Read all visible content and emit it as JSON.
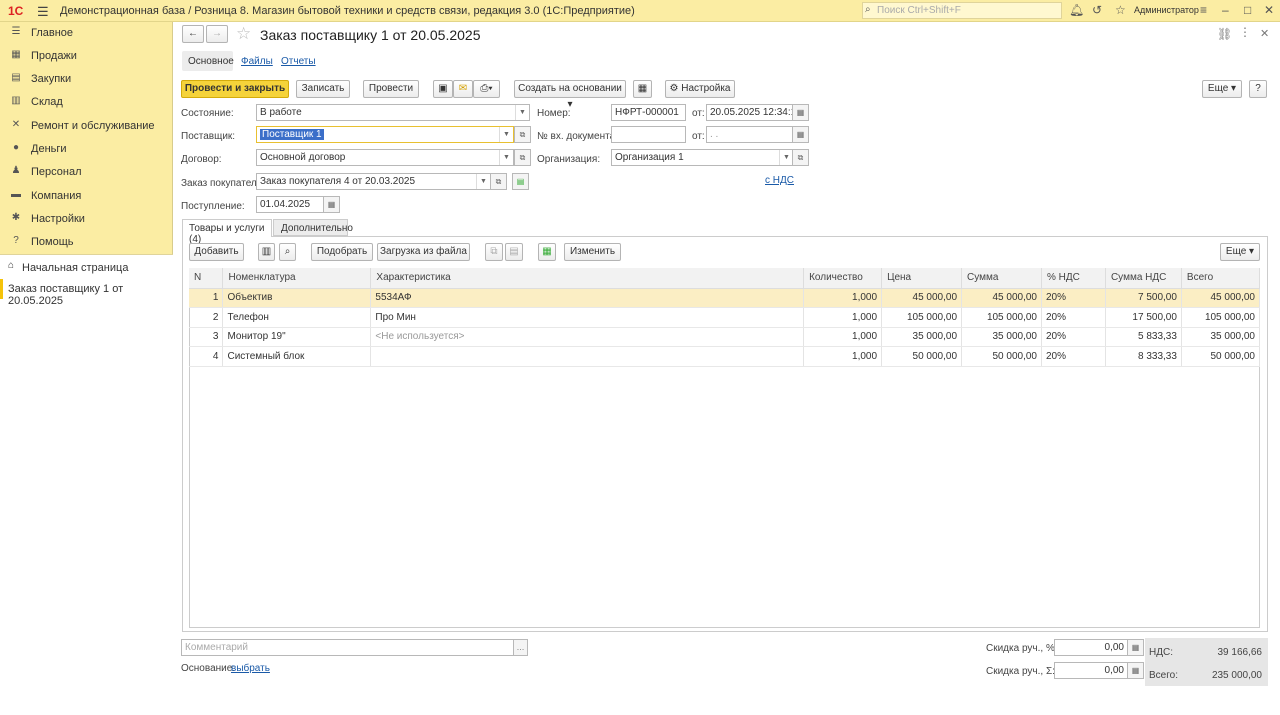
{
  "app": {
    "logo": "1С",
    "title": "Демонстрационная база / Розница 8. Магазин бытовой техники и средств связи, редакция 3.0  (1С:Предприятие)",
    "search_placeholder": "Поиск Ctrl+Shift+F",
    "user": "Администратор"
  },
  "sidebar": {
    "items": [
      {
        "label": "Главное",
        "icon": "menu-icon"
      },
      {
        "label": "Продажи",
        "icon": "cart-icon"
      },
      {
        "label": "Закупки",
        "icon": "purchase-icon"
      },
      {
        "label": "Склад",
        "icon": "warehouse-icon"
      },
      {
        "label": "Ремонт и обслуживание",
        "icon": "wrench-icon"
      },
      {
        "label": "Деньги",
        "icon": "money-icon"
      },
      {
        "label": "Персонал",
        "icon": "people-icon"
      },
      {
        "label": "Компания",
        "icon": "company-icon"
      },
      {
        "label": "Настройки",
        "icon": "settings-icon"
      },
      {
        "label": "Помощь",
        "icon": "help-icon"
      }
    ],
    "home": "Начальная страница",
    "active_doc": "Заказ поставщику 1 от 20.05.2025"
  },
  "doc": {
    "title": "Заказ поставщику 1 от 20.05.2025",
    "tabs": [
      "Основное",
      "Файлы",
      "Отчеты"
    ]
  },
  "toolbar": {
    "post_close": "Провести и закрыть",
    "save": "Записать",
    "post": "Провести",
    "create_based": "Создать на основании",
    "settings": "Настройка",
    "more": "Еще",
    "help": "?"
  },
  "form": {
    "state_label": "Состояние:",
    "state_value": "В работе",
    "supplier_label": "Поставщик:",
    "supplier_value": "Поставщик 1",
    "contract_label": "Договор:",
    "contract_value": "Основной договор",
    "customer_order_label": "Заказ покупателя:",
    "customer_order_value": "Заказ покупателя 4 от 20.03.2025",
    "receipt_label": "Поступление:",
    "receipt_value": "01.04.2025",
    "number_label": "Номер:",
    "number_value": "НФРТ-000001",
    "from_label": "от:",
    "date_value": "20.05.2025 12:34:19",
    "in_doc_label": "№ вх. документа:",
    "in_doc_value": "",
    "in_date_value": " .  .",
    "org_label": "Организация:",
    "org_value": "Организация 1",
    "vat_link": "с НДС"
  },
  "subtabs": [
    "Товары и услуги (4)",
    "Дополнительно"
  ],
  "gridbar": {
    "add": "Добавить",
    "pick": "Подобрать",
    "load": "Загрузка из файла",
    "change": "Изменить",
    "more": "Еще"
  },
  "table": {
    "headers": [
      "N",
      "Номенклатура",
      "Характеристика",
      "Количество",
      "Цена",
      "Сумма",
      "% НДС",
      "Сумма НДС",
      "Всего"
    ],
    "rows": [
      [
        "1",
        "Объектив",
        "5534АФ",
        "1,000",
        "45 000,00",
        "45 000,00",
        "20%",
        "7 500,00",
        "45 000,00"
      ],
      [
        "2",
        "Телефон",
        "Про Мин",
        "1,000",
        "105 000,00",
        "105 000,00",
        "20%",
        "17 500,00",
        "105 000,00"
      ],
      [
        "3",
        "Монитор 19\"",
        "<Не используется>",
        "1,000",
        "35 000,00",
        "35 000,00",
        "20%",
        "5 833,33",
        "35 000,00"
      ],
      [
        "4",
        "Системный блок",
        "",
        "1,000",
        "50 000,00",
        "50 000,00",
        "20%",
        "8 333,33",
        "50 000,00"
      ]
    ]
  },
  "footer": {
    "comment_placeholder": "Комментарий",
    "basis_label": "Основание:",
    "basis_link": "выбрать",
    "disc_pct_label": "Скидка руч., %:",
    "disc_pct_value": "0,00",
    "disc_sum_label": "Скидка руч., Σ:",
    "disc_sum_value": "0,00",
    "vat_label": "НДС:",
    "vat_value": "39 166,66",
    "total_label": "Всего:",
    "total_value": "235 000,00"
  }
}
